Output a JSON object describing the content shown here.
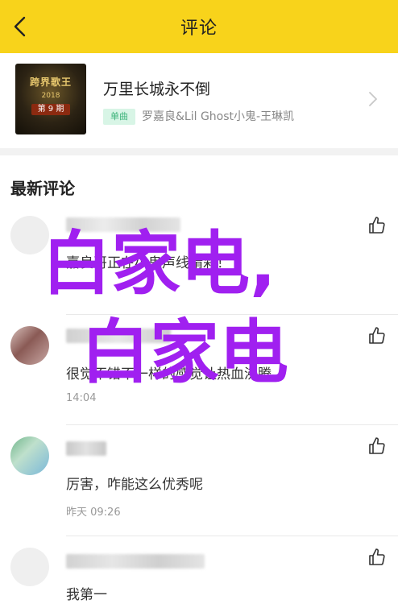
{
  "header": {
    "title": "评论",
    "back_icon": "chevron-left-icon"
  },
  "song": {
    "title": "万里长城永不倒",
    "tag": "单曲",
    "artist": "罗嘉良&Lil Ghost小鬼-王琳凯",
    "cover_line1": "跨界歌王",
    "cover_year": "2018",
    "cover_episode": "第 9 期"
  },
  "comments_section": {
    "title": "最新评论"
  },
  "comments": [
    {
      "text": "嘉良哥正在小鬼声线精彩！",
      "time": ""
    },
    {
      "text": "很觉不错不一样的感觉让热血沸腾",
      "time": "14:04"
    },
    {
      "text": "厉害，咋能这么优秀呢",
      "time": "昨天 09:26"
    },
    {
      "text": "我第一",
      "time": ""
    }
  ],
  "watermark": {
    "line1": "白家电,",
    "line2": "白家电"
  },
  "colors": {
    "accent": "#f8d31b",
    "tag_bg": "#d8f5e6",
    "tag_text": "#3db37a",
    "watermark": "#a020f0"
  }
}
